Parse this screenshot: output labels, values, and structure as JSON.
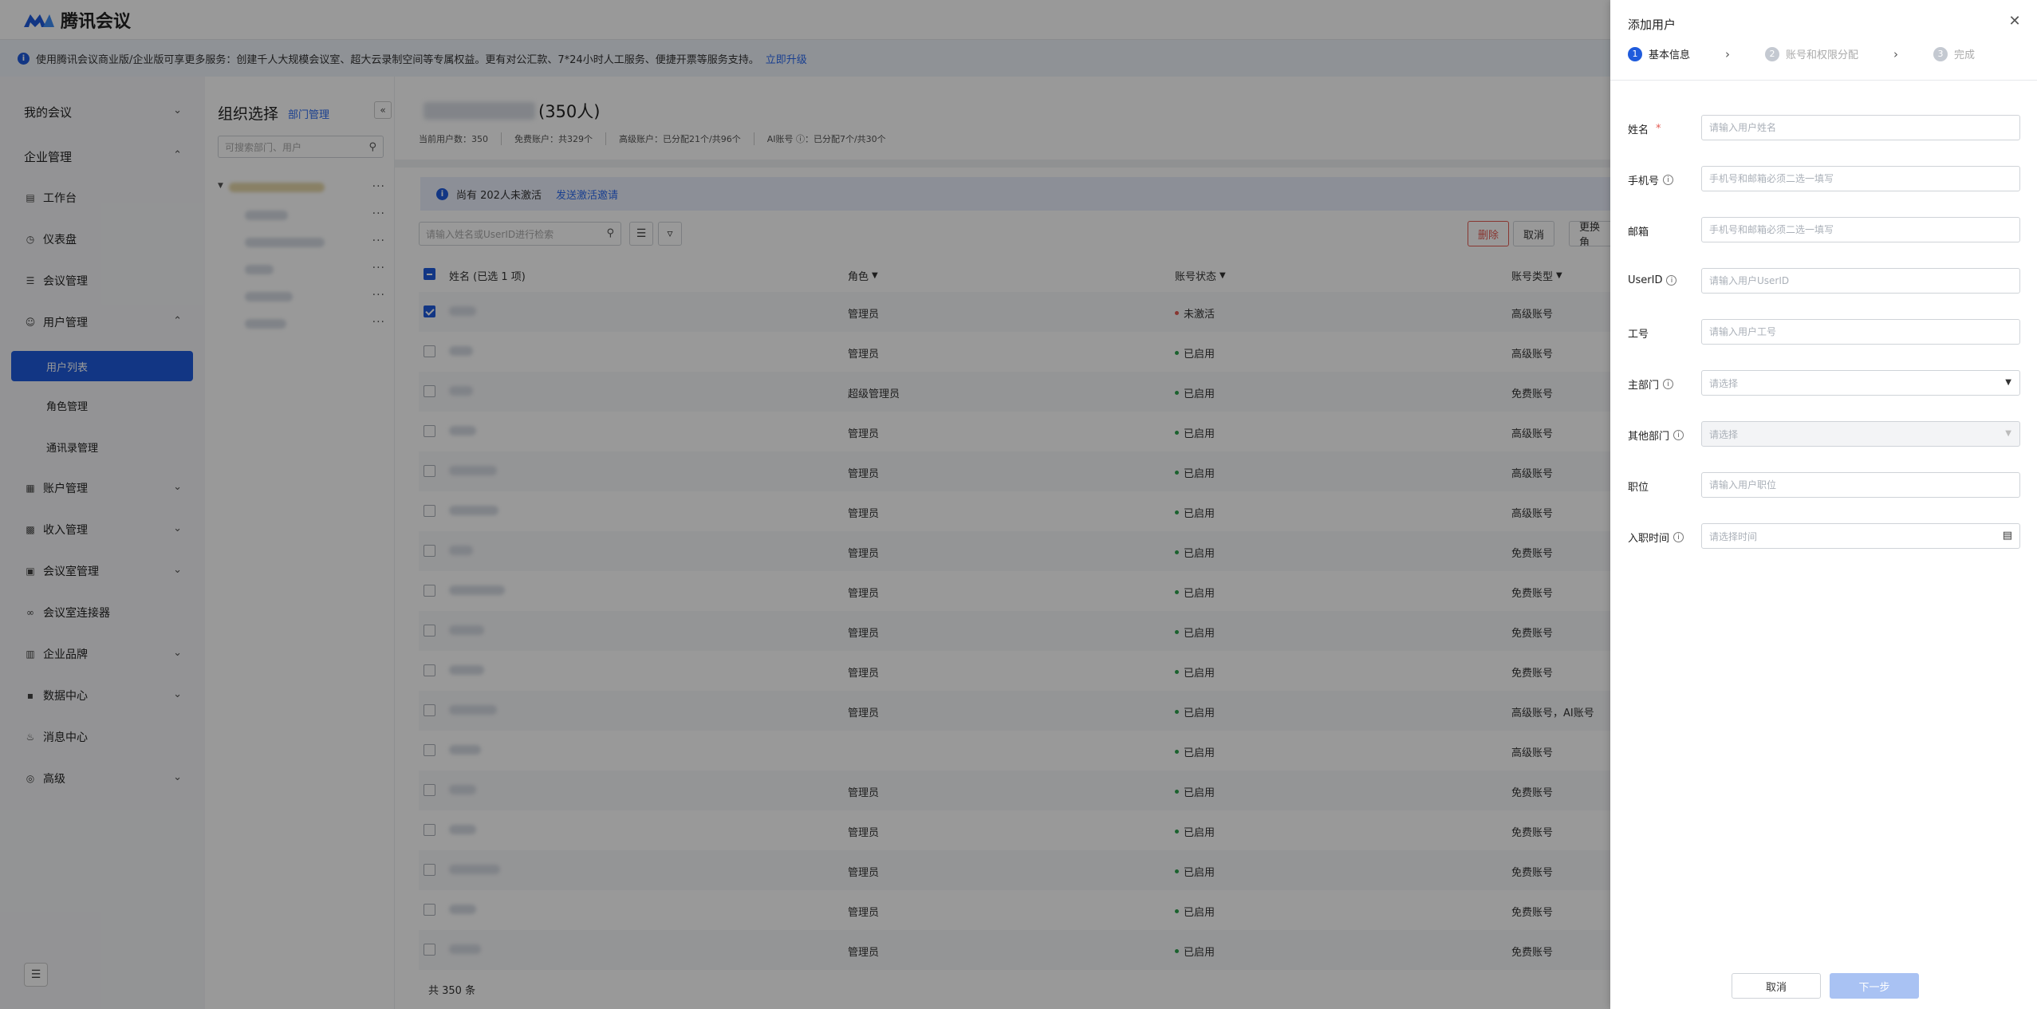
{
  "app": {
    "brand": "腾讯会议",
    "notice_text": "使用腾讯会议商业版/企业版可享更多服务：创建千人大规模会议室、超大云录制空间等专属权益。更有对公汇款、7*24小时人工服务、便捷开票等服务支持。",
    "notice_link": "立即升级"
  },
  "sidebar": {
    "items": [
      {
        "label": "我的会议",
        "icon": "chevron-icon",
        "type": "group",
        "expanded": false
      },
      {
        "label": "企业管理",
        "icon": "chevron-icon",
        "type": "group",
        "expanded": true
      },
      {
        "label": "工作台",
        "icon": "workbench-icon",
        "type": "item"
      },
      {
        "label": "仪表盘",
        "icon": "dashboard-icon",
        "type": "item"
      },
      {
        "label": "会议管理",
        "icon": "meeting-list-icon",
        "type": "item"
      },
      {
        "label": "用户管理",
        "icon": "user-icon",
        "type": "item-expandable",
        "expanded": true
      },
      {
        "label": "用户列表",
        "type": "sub",
        "active": true
      },
      {
        "label": "角色管理",
        "type": "sub"
      },
      {
        "label": "通讯录管理",
        "type": "sub"
      },
      {
        "label": "账户管理",
        "icon": "account-icon",
        "type": "item-expandable"
      },
      {
        "label": "收入管理",
        "icon": "income-icon",
        "type": "item-expandable"
      },
      {
        "label": "会议室管理",
        "icon": "room-icon",
        "type": "item-expandable"
      },
      {
        "label": "会议室连接器",
        "icon": "link-icon",
        "type": "item"
      },
      {
        "label": "企业品牌",
        "icon": "brand-icon",
        "type": "item-expandable"
      },
      {
        "label": "数据中心",
        "icon": "data-icon",
        "type": "item-expandable"
      },
      {
        "label": "消息中心",
        "icon": "bell-icon",
        "type": "item"
      },
      {
        "label": "高级",
        "icon": "advanced-icon",
        "type": "item-expandable"
      }
    ]
  },
  "org": {
    "title": "组织选择",
    "manage_link": "部门管理",
    "search_placeholder": "可搜索部门、用户"
  },
  "main": {
    "title_suffix": "(350人)",
    "stats": [
      "当前用户数：350",
      "免费账户：共329个",
      "高级账户：已分配21个/共96个",
      "AI账号 ⓘ：已分配7个/共30个"
    ],
    "activate_text": "尚有 202人未激活",
    "activate_link": "发送激活邀请",
    "search_placeholder": "请输入姓名或UserID进行检索",
    "actions": {
      "delete": "删除",
      "cancel": "取消",
      "change_role": "更换角"
    },
    "columns": {
      "name": "姓名 (已选 1 项)",
      "role": "角色",
      "status": "账号状态",
      "type": "账号类型"
    },
    "rows": [
      {
        "role": "管理员",
        "status": "未激活",
        "active": false,
        "type": "高级账号",
        "checked": true
      },
      {
        "role": "管理员",
        "status": "已启用",
        "active": true,
        "type": "高级账号",
        "checked": false
      },
      {
        "role": "超级管理员",
        "status": "已启用",
        "active": true,
        "type": "免费账号",
        "checked": false
      },
      {
        "role": "管理员",
        "status": "已启用",
        "active": true,
        "type": "高级账号",
        "checked": false
      },
      {
        "role": "管理员",
        "status": "已启用",
        "active": true,
        "type": "高级账号",
        "checked": false
      },
      {
        "role": "管理员",
        "status": "已启用",
        "active": true,
        "type": "高级账号",
        "checked": false
      },
      {
        "role": "管理员",
        "status": "已启用",
        "active": true,
        "type": "免费账号",
        "checked": false
      },
      {
        "role": "管理员",
        "status": "已启用",
        "active": true,
        "type": "免费账号",
        "checked": false
      },
      {
        "role": "管理员",
        "status": "已启用",
        "active": true,
        "type": "免费账号",
        "checked": false
      },
      {
        "role": "管理员",
        "status": "已启用",
        "active": true,
        "type": "免费账号",
        "checked": false
      },
      {
        "role": "管理员",
        "status": "已启用",
        "active": true,
        "type": "高级账号，AI账号",
        "checked": false
      },
      {
        "role": "",
        "status": "已启用",
        "active": true,
        "type": "高级账号",
        "checked": false
      },
      {
        "role": "管理员",
        "status": "已启用",
        "active": true,
        "type": "免费账号",
        "checked": false
      },
      {
        "role": "管理员",
        "status": "已启用",
        "active": true,
        "type": "免费账号",
        "checked": false
      },
      {
        "role": "管理员",
        "status": "已启用",
        "active": true,
        "type": "免费账号",
        "checked": false
      },
      {
        "role": "管理员",
        "status": "已启用",
        "active": true,
        "type": "免费账号",
        "checked": false
      },
      {
        "role": "管理员",
        "status": "已启用",
        "active": true,
        "type": "免费账号",
        "checked": false
      }
    ],
    "total": "共  350  条"
  },
  "drawer": {
    "title": "添加用户",
    "steps": [
      {
        "num": "1",
        "label": "基本信息",
        "active": true
      },
      {
        "num": "2",
        "label": "账号和权限分配",
        "active": false
      },
      {
        "num": "3",
        "label": "完成",
        "active": false
      }
    ],
    "fields": [
      {
        "label": "姓名",
        "required": true,
        "help": false,
        "kind": "input",
        "placeholder": "请输入用户姓名"
      },
      {
        "label": "手机号",
        "required": false,
        "help": true,
        "kind": "input",
        "placeholder": "手机号和邮箱必须二选一填写"
      },
      {
        "label": "邮箱",
        "required": false,
        "help": false,
        "kind": "input",
        "placeholder": "手机号和邮箱必须二选一填写"
      },
      {
        "label": "UserID",
        "required": false,
        "help": true,
        "kind": "input",
        "placeholder": "请输入用户UserID"
      },
      {
        "label": "工号",
        "required": false,
        "help": false,
        "kind": "input",
        "placeholder": "请输入用户工号"
      },
      {
        "label": "主部门",
        "required": false,
        "help": true,
        "kind": "select",
        "placeholder": "请选择"
      },
      {
        "label": "其他部门",
        "required": false,
        "help": true,
        "kind": "select-disabled",
        "placeholder": "请选择"
      },
      {
        "label": "职位",
        "required": false,
        "help": false,
        "kind": "input",
        "placeholder": "请输入用户职位"
      },
      {
        "label": "入职时间",
        "required": false,
        "help": true,
        "kind": "date",
        "placeholder": "请选择时间"
      }
    ],
    "cancel": "取消",
    "next": "下一步"
  },
  "colors": {
    "primary": "#1f5bdc",
    "success": "#2da44e",
    "danger": "#e35a52",
    "overlay": "rgba(0,0,0,0.40)"
  }
}
